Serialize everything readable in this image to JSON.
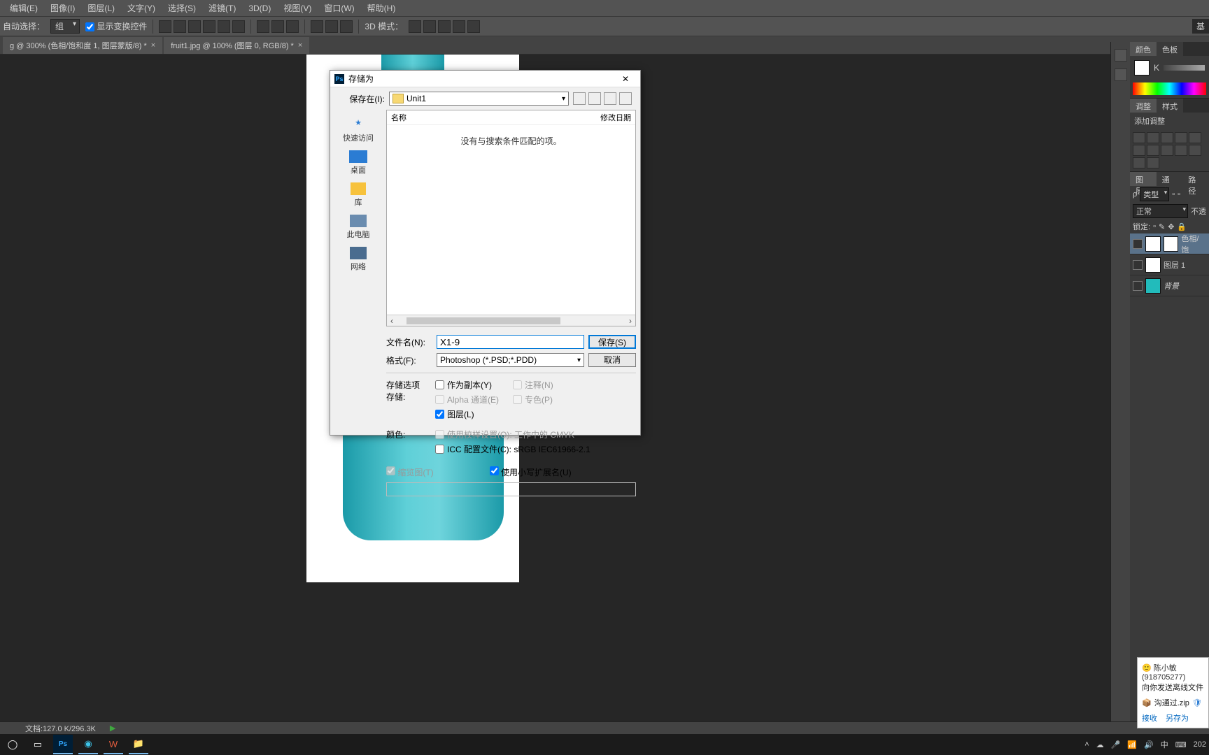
{
  "menu": {
    "edit": "编辑(E)",
    "image": "图像(I)",
    "layer": "图层(L)",
    "type": "文字(Y)",
    "select": "选择(S)",
    "filter": "滤镜(T)",
    "d3": "3D(D)",
    "view": "视图(V)",
    "window": "窗口(W)",
    "help": "帮助(H)"
  },
  "options": {
    "auto": "自动选择：",
    "group": "组",
    "show": "显示变换控件",
    "mode3d": "3D 模式："
  },
  "tabs": {
    "t1": "g @ 300% (色相/饱和度 1, 图层蒙版/8) *",
    "t2": "fruit1.jpg @ 100% (图层 0, RGB/8) *"
  },
  "dialog": {
    "title": "存储为",
    "saveIn": "保存在(I):",
    "folder": "Unit1",
    "colName": "名称",
    "colDate": "修改日期",
    "empty": "没有与搜索条件匹配的项。",
    "sb": {
      "quick": "快速访问",
      "desktop": "桌面",
      "lib": "库",
      "pc": "此电脑",
      "net": "网络"
    },
    "filename_l": "文件名(N):",
    "filename_v": "X1-9",
    "format_l": "格式(F):",
    "format_v": "Photoshop (*.PSD;*.PDD)",
    "save": "保存(S)",
    "cancel": "取消",
    "sect_opt": "存储选项",
    "store": "存储:",
    "copy": "作为副本(Y)",
    "alpha": "Alpha 通道(E)",
    "layers": "图层(L)",
    "notes": "注释(N)",
    "spot": "专色(P)",
    "color": "颜色:",
    "proof": "使用校样设置(O):  工作中的 CMYK",
    "icc": "ICC 配置文件(C):  sRGB IEC61966-2.1",
    "thumb": "缩览图(T)",
    "lowerext": "使用小写扩展名(U)"
  },
  "rp": {
    "color": "颜色",
    "swatches": "色板",
    "k": "K",
    "adjust": "调整",
    "styles": "样式",
    "add": "添加调整",
    "layers": "图层",
    "channels": "通道",
    "paths": "路径",
    "kind": "类型",
    "normal": "正常",
    "opacity": "不透",
    "lock": "锁定:",
    "l1": "色相/饱",
    "l2": "图层 1",
    "l3": "背景"
  },
  "status": {
    "doc": "文档:127.0 K/296.3K"
  },
  "notif": {
    "name": "陈小敏(918705277)",
    "msg": "向你发送离线文件",
    "file": "沟通过.zip",
    "accept": "接收",
    "saveas": "另存为"
  },
  "tray": {
    "ime": "中",
    "date": "202"
  },
  "base": "基"
}
